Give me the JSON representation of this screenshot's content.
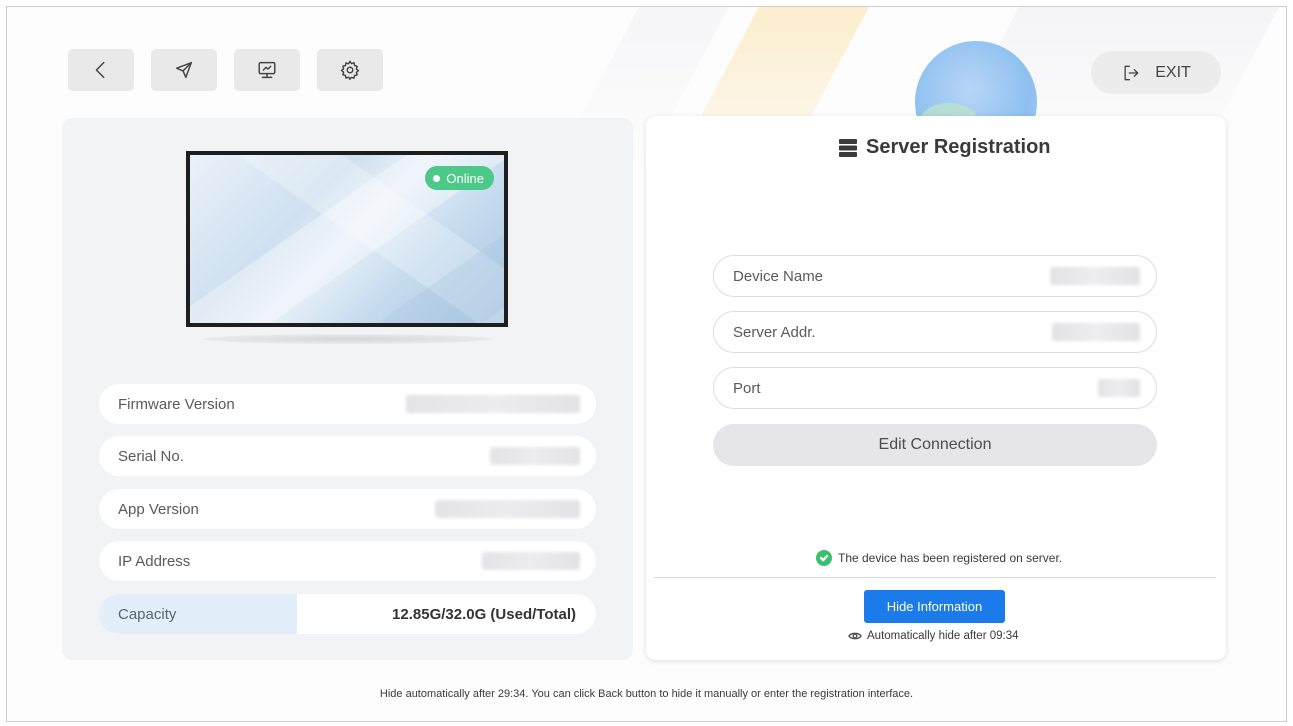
{
  "toolbar": {
    "icons": [
      "back-icon",
      "send-icon",
      "screen-icon",
      "settings-icon"
    ],
    "exit_label": "EXIT"
  },
  "device": {
    "status": "Online",
    "status_color": "#4cc888"
  },
  "info": {
    "firmware_label": "Firmware Version",
    "serial_label": "Serial No.",
    "app_label": "App Version",
    "ip_label": "IP Address",
    "capacity_label": "Capacity",
    "capacity_value": "12.85G/32.0G (Used/Total)"
  },
  "server": {
    "title": "Server Registration",
    "device_name_label": "Device Name",
    "server_addr_label": "Server Addr.",
    "port_label": "Port",
    "edit_label": "Edit Connection",
    "status_text": "The device has been registered on server.",
    "hide_label": "Hide Information",
    "auto_hide_text": "Automatically hide after 09:34"
  },
  "footer": {
    "note": "Hide automatically after 29:34. You can click Back button to hide it manually or enter the registration interface."
  },
  "colors": {
    "accent": "#1b7bea",
    "success": "#3bbf6e",
    "capacity_highlight": "#e2eef9"
  }
}
